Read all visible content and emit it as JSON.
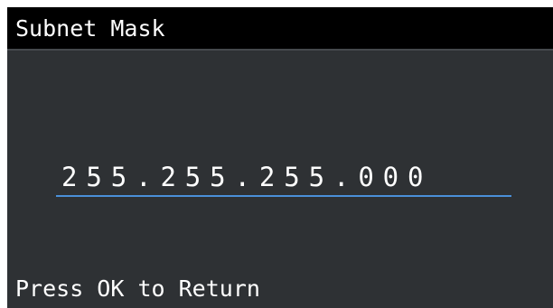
{
  "header": {
    "title": "Subnet Mask"
  },
  "field": {
    "value": "255.255.255.000"
  },
  "footer": {
    "hint": "Press OK to Return"
  },
  "colors": {
    "screen_background": "#2e3134",
    "header_background": "#000000",
    "text": "#ffffff",
    "underline_accent": "#4a90d9"
  }
}
